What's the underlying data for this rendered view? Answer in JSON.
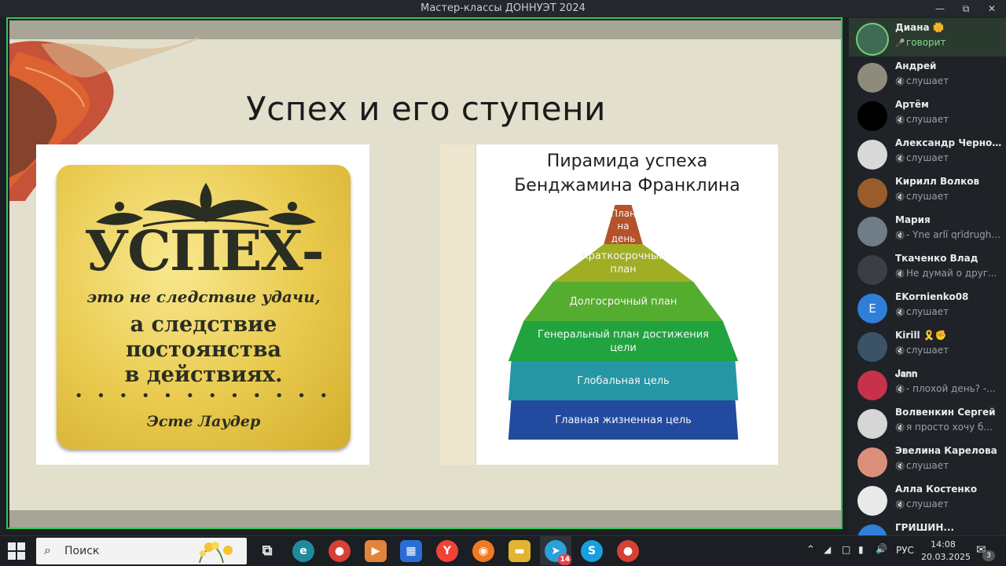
{
  "window": {
    "title": "Мастер-классы ДОННУЭТ 2024",
    "minimize_icon": "minimize-icon",
    "maximize_icon": "restore-icon",
    "close_icon": "close-icon"
  },
  "slide": {
    "title": "Успех и его ступени",
    "left_image": {
      "headline": "УСПЕХ-",
      "line1": "это не следствие удачи,",
      "line2": "а следствие\nпостоянства\nв действиях.",
      "dots": "• • • • • • • • • • • •",
      "author": "Эсте Лаудер"
    },
    "right_image": {
      "title": "Пирамида успеха\nБенджамина Франклина",
      "levels": [
        {
          "label": "План\nна\nдень",
          "color": "#b4532a"
        },
        {
          "label": "Краткосрочный\nплан",
          "color": "#9fae25"
        },
        {
          "label": "Долгосрочный план",
          "color": "#55ad2f"
        },
        {
          "label": "Генеральный план достижения\nцели",
          "color": "#21a340"
        },
        {
          "label": "Глобальная цель",
          "color": "#2597a4"
        },
        {
          "label": "Главная жизненная цель",
          "color": "#224a9e"
        }
      ]
    }
  },
  "participants": [
    {
      "name": "Диана 🌼",
      "status": "говорит",
      "speaking": true,
      "avatar_color": "#3f6b55",
      "initial": ""
    },
    {
      "name": "Андрей",
      "status": "слушает",
      "speaking": false,
      "avatar_color": "#8f8b7c",
      "initial": ""
    },
    {
      "name": "Артём",
      "status": "слушает",
      "speaking": false,
      "avatar_color": "#000000",
      "initial": ""
    },
    {
      "name": "Александр Черно...",
      "status": "слушает",
      "speaking": false,
      "avatar_color": "#d9d9d9",
      "initial": ""
    },
    {
      "name": "Кирилл Волков",
      "status": "слушает",
      "speaking": false,
      "avatar_color": "#9a5c2a",
      "initial": ""
    },
    {
      "name": "Мария",
      "status": "- Yne arlī qrïdrugh...",
      "speaking": false,
      "avatar_color": "#6e7d86",
      "initial": ""
    },
    {
      "name": "Ткаченко Влад",
      "status": "Не думай о друг...",
      "speaking": false,
      "avatar_color": "#3b3f45",
      "initial": ""
    },
    {
      "name": "EKornienko08",
      "status": "слушает",
      "speaking": false,
      "avatar_color": "#2f7fd8",
      "initial": "E"
    },
    {
      "name": "Kirill 🎗️✊",
      "status": "слушает",
      "speaking": false,
      "avatar_color": "#3a5466",
      "initial": ""
    },
    {
      "name": "𝐉𝐚𝐧𝐧",
      "status": "- плохой день? -...",
      "speaking": false,
      "avatar_color": "#c7314a",
      "initial": ""
    },
    {
      "name": "Волвенкин Сергей",
      "status": "я просто хочу б...",
      "speaking": false,
      "avatar_color": "#d6d6d6",
      "initial": ""
    },
    {
      "name": "Эвелина Карелова",
      "status": "слушает",
      "speaking": false,
      "avatar_color": "#d98f7a",
      "initial": ""
    },
    {
      "name": "Алла Костенко",
      "status": "слушает",
      "speaking": false,
      "avatar_color": "#e9e9e9",
      "initial": ""
    },
    {
      "name": "ГРИШИН...",
      "status": "",
      "speaking": false,
      "avatar_color": "#2f7fd8",
      "initial": ""
    }
  ],
  "taskbar": {
    "search_placeholder": "Поиск",
    "apps": [
      {
        "name": "task-view-icon",
        "label": "⧉",
        "color": "#1b1e22"
      },
      {
        "name": "edge-icon",
        "label": "e",
        "color": "#1f8a9e"
      },
      {
        "name": "chrome-icon",
        "label": "●",
        "color": "#d64135"
      },
      {
        "name": "media-player-icon",
        "label": "▶",
        "color": "#e2843a"
      },
      {
        "name": "store-icon",
        "label": "▦",
        "color": "#2b6dd6"
      },
      {
        "name": "yandex-browser-icon",
        "label": "Y",
        "color": "#f04336"
      },
      {
        "name": "firefox-icon",
        "label": "◉",
        "color": "#f07a22"
      },
      {
        "name": "file-explorer-icon",
        "label": "▬",
        "color": "#e3b431"
      },
      {
        "name": "telegram-icon",
        "label": "➤",
        "color": "#2aa1da"
      },
      {
        "name": "skype-icon",
        "label": "S",
        "color": "#1a9ee0"
      },
      {
        "name": "chrome-profile-icon",
        "label": "●",
        "color": "#d64135"
      }
    ],
    "telegram_badge": "14",
    "language": "РУС",
    "time": "14:08",
    "date": "20.03.2025",
    "notification_count": "3"
  }
}
